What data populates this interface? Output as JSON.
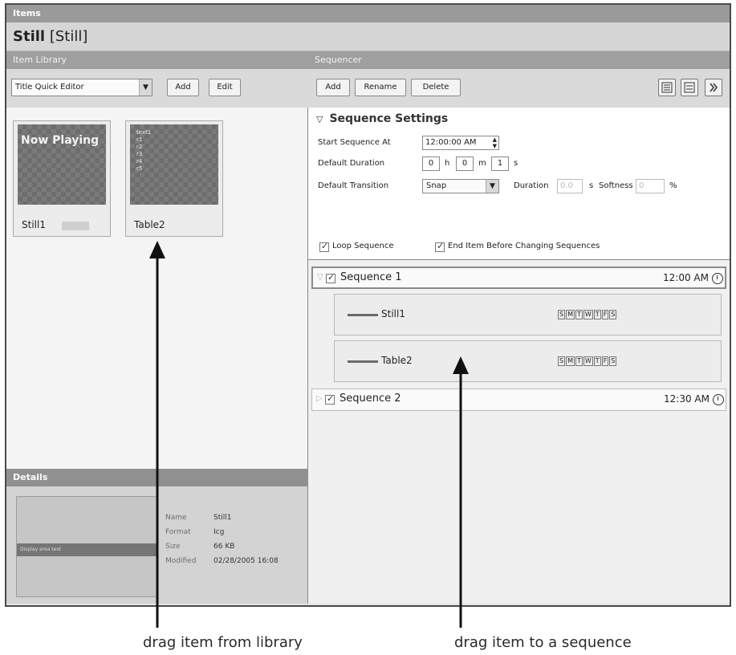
{
  "header": {
    "bar_label": "Items",
    "title_bold": "Still",
    "title_rest": "[Still]"
  },
  "library": {
    "bar_label": "Item Library",
    "editor_select": "Title Quick Editor",
    "add_label": "Add",
    "edit_label": "Edit",
    "items": [
      {
        "name": "Still1",
        "thumb_text": "Now Playing"
      },
      {
        "name": "Table2",
        "thumb_lines": [
          "text1",
          "r1",
          "r2",
          "r3",
          "r4",
          "r5"
        ]
      }
    ]
  },
  "details": {
    "bar_label": "Details",
    "preview_text": "Display area text",
    "fields": [
      {
        "label": "Name",
        "value": "Still1"
      },
      {
        "label": "Format",
        "value": "Icg"
      },
      {
        "label": "Size",
        "value": "66 KB"
      },
      {
        "label": "Modified",
        "value": "02/28/2005 16:08"
      }
    ]
  },
  "sequencer": {
    "bar_label": "Sequencer",
    "add_label": "Add",
    "rename_label": "Rename",
    "delete_label": "Delete",
    "settings": {
      "heading": "Sequence Settings",
      "start_label": "Start Sequence At",
      "start_value": "12:00:00 AM",
      "duration_label": "Default Duration",
      "hours": "0",
      "hours_unit": "h",
      "minutes": "0",
      "minutes_unit": "m",
      "seconds": "1",
      "seconds_unit": "s",
      "transition_label": "Default Transition",
      "transition_value": "Snap",
      "trans_duration_label": "Duration",
      "trans_duration_value": "0.0",
      "trans_duration_unit": "s",
      "softness_label": "Softness",
      "softness_value": "0",
      "softness_unit": "%",
      "loop_label": "Loop Sequence",
      "end_item_label": "End Item Before Changing Sequences"
    },
    "sequences": [
      {
        "name": "Sequence 1",
        "time": "12:00 AM",
        "items": [
          "Still1",
          "Table2"
        ]
      },
      {
        "name": "Sequence 2",
        "time": "12:30 AM"
      }
    ],
    "days": [
      "S",
      "M",
      "T",
      "W",
      "T",
      "F",
      "S"
    ]
  },
  "captions": {
    "left": "drag item from library",
    "right": "drag item to a sequence"
  }
}
